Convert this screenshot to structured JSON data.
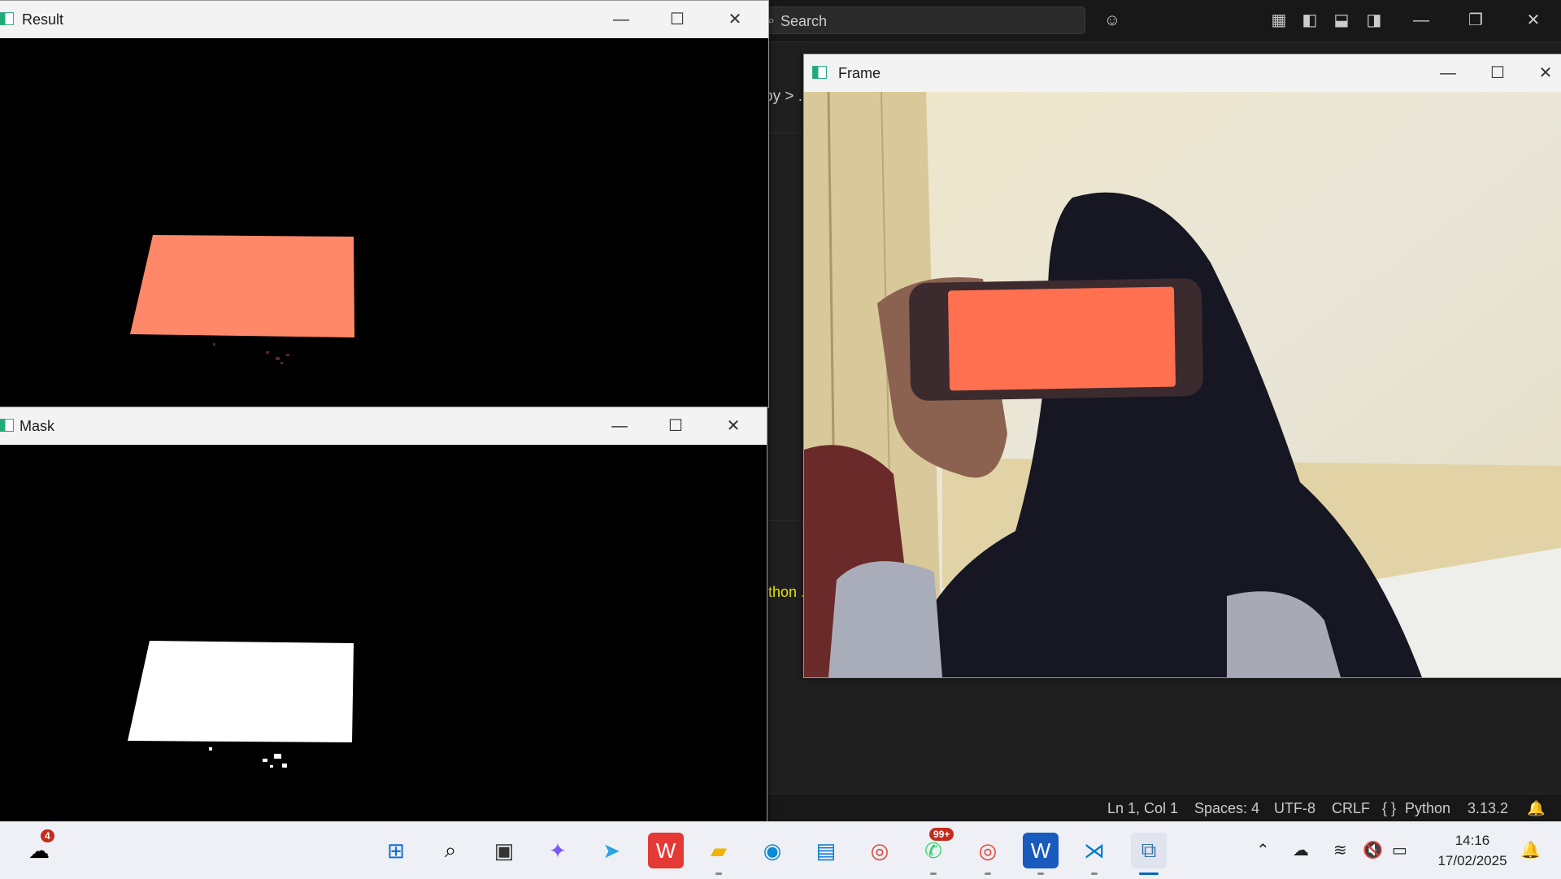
{
  "vscode": {
    "search_placeholder": "Search",
    "breadcrumb": "py > .",
    "terminal_text": "thon .",
    "status": {
      "position": "Ln 1, Col 1",
      "spaces": "Spaces: 4",
      "encoding": "UTF-8",
      "eol": "CRLF",
      "language": "Python",
      "language_icon": "{ }",
      "version": "3.13.2"
    }
  },
  "windows": {
    "result": {
      "title": "Result"
    },
    "mask": {
      "title": "Mask"
    },
    "frame": {
      "title": "Frame"
    }
  },
  "controls": {
    "minimize": "—",
    "maximize": "☐",
    "close": "✕"
  },
  "taskbar": {
    "weather_badge": "4",
    "whatsapp_badge": "99+",
    "clock_time": "14:16",
    "clock_date": "17/02/2025",
    "apps": [
      "start-icon",
      "search-icon",
      "task-view-icon",
      "copilot-icon",
      "telegram-icon",
      "wps-icon",
      "file-explorer-icon",
      "edge-icon",
      "store-icon",
      "chrome-icon",
      "whatsapp-icon",
      "chrome-profile-icon",
      "word-icon",
      "vscode-icon",
      "python-icon"
    ]
  },
  "colors": {
    "phone_screen": "#ff7050",
    "result_rect": "#ff8868",
    "mask_white": "#ffffff",
    "vscode_bg": "#1f1f1f",
    "taskbar_bg": "#eef0f5"
  }
}
